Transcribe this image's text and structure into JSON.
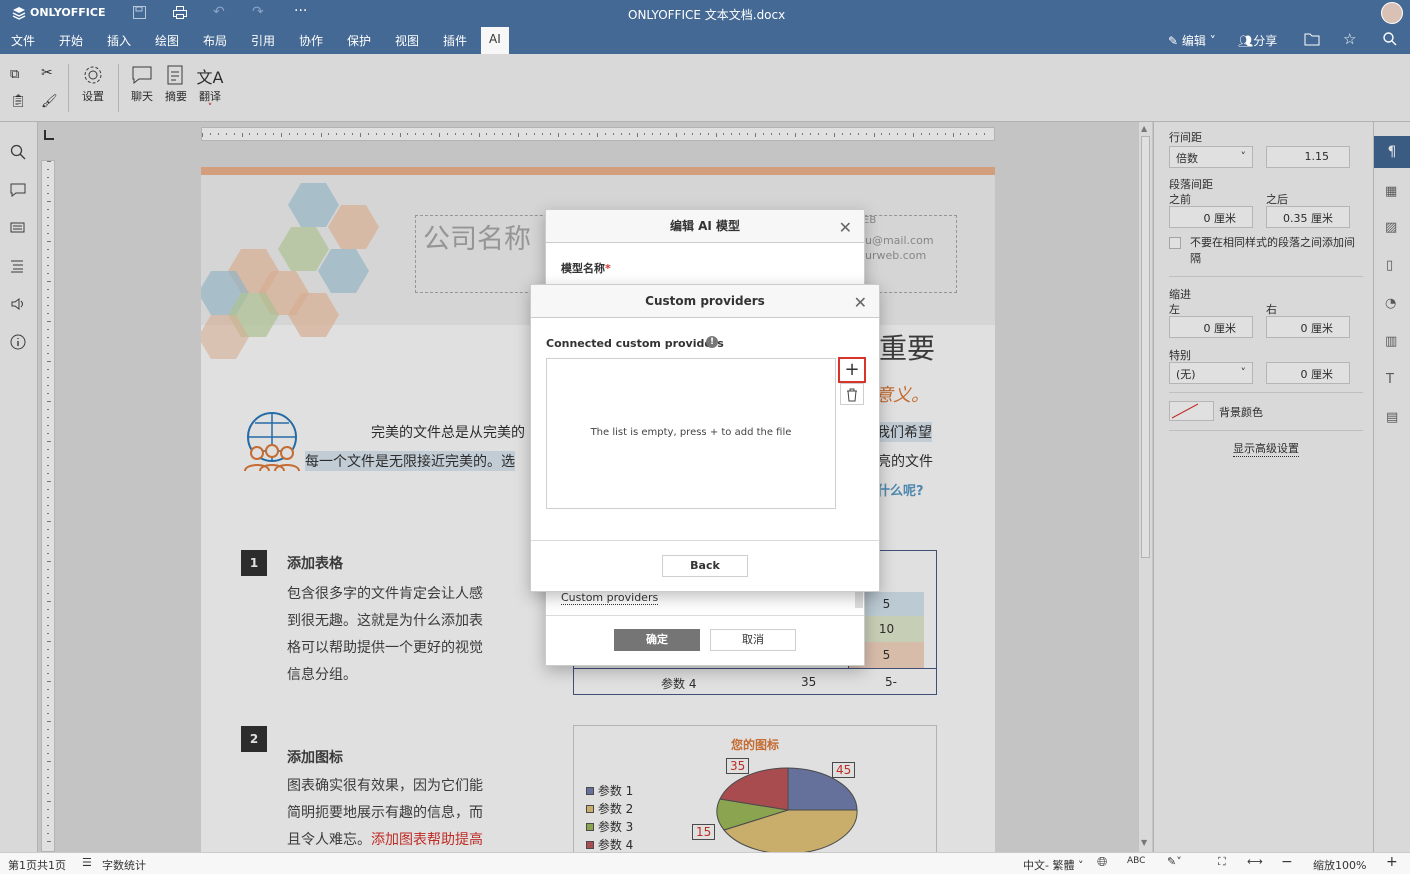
{
  "app": {
    "logo": "ONLYOFFICE",
    "doc_title": "ONLYOFFICE 文本文档.docx"
  },
  "menu": {
    "tabs": [
      "文件",
      "开始",
      "插入",
      "绘图",
      "布局",
      "引用",
      "协作",
      "保护",
      "视图",
      "插件",
      "AI"
    ],
    "edit": "编辑",
    "share": "分享"
  },
  "toolbar": {
    "settings": "设置",
    "chat": "聊天",
    "summary": "摘要",
    "translate": "翻译"
  },
  "document": {
    "company": "公司名称",
    "web_partial": "EB",
    "mail_partial": "u@mail.com",
    "url_partial": "urweb.com",
    "heading_partial": "重要",
    "subheading_partial": "意义。",
    "para1_a": "完美的文件总是从完美的",
    "para1_b": "我们希望",
    "para1_c": "每一个文件是无限接近完美的。选",
    "para1_d": "亮的文件",
    "question_partial": "什么呢?",
    "sec1_num": "1",
    "sec1_title": "添加表格",
    "sec1_body": [
      "包含很多字的文件肯定会让人感",
      "到很无趣。这就是为什么添加表",
      "格可以帮助提供一个更好的视觉",
      "信息分组。"
    ],
    "sec2_num": "2",
    "sec2_title": "添加图标",
    "sec2_body": [
      "图表确实很有效果，因为它们能",
      "简明扼要地展示有趣的信息，而",
      "且令人难忘。"
    ],
    "sec2_red": "添加图表帮助提高",
    "table_cells": [
      "5",
      "10",
      "5",
      "5-"
    ],
    "table_row4": "参数 4",
    "table_row4_val": "35",
    "chart_title": "您的图标",
    "chart_labels": [
      "45",
      "35",
      "15"
    ],
    "legend": [
      "参数 1",
      "参数 2",
      "参数 3",
      "参数 4"
    ]
  },
  "ai_dialog": {
    "title": "编辑 AI 模型",
    "model_name_label": "模型名称",
    "required_mark": "*",
    "link": "Custom providers",
    "ok": "确定",
    "cancel": "取消"
  },
  "providers_dialog": {
    "title": "Custom providers",
    "section": "Connected custom providers",
    "empty_text": "The list is empty, press + to add the file",
    "back": "Back"
  },
  "right_panel": {
    "line_spacing": "行间距",
    "line_mode": "倍数",
    "line_value": "1.15",
    "para_spacing": "段落间距",
    "before": "之前",
    "after": "之后",
    "before_val": "0 厘米",
    "after_val": "0.35 厘米",
    "no_space_same": "不要在相同样式的段落之间添加间隔",
    "indent": "缩进",
    "left": "左",
    "right": "右",
    "left_val": "0 厘米",
    "right_val": "0 厘米",
    "special": "特别",
    "special_mode": "(无)",
    "special_val": "0 厘米",
    "bg_color": "背景颜色",
    "advanced": "显示高级设置"
  },
  "status": {
    "page": "第1页共1页",
    "word_count": "字数统计",
    "language": "中文- 繁體",
    "zoom": "缩放100%"
  },
  "chart_data": {
    "type": "pie",
    "title": "您的图标",
    "categories": [
      "参数 1",
      "参数 2",
      "参数 3",
      "参数 4"
    ],
    "values": [
      45,
      null,
      15,
      35
    ]
  }
}
